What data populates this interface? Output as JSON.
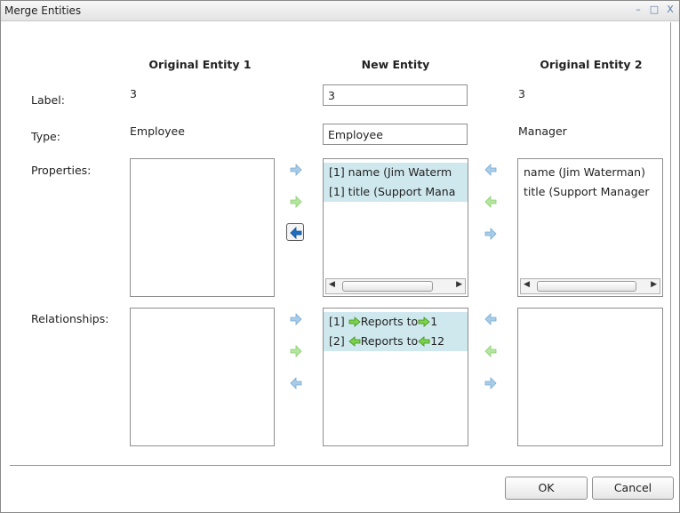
{
  "window": {
    "title": "Merge Entities",
    "minimize": "–",
    "maximize": "□",
    "close": "X"
  },
  "headers": {
    "entity1": "Original Entity 1",
    "new": "New Entity",
    "entity2": "Original Entity 2"
  },
  "labels": {
    "label": "Label:",
    "type": "Type:",
    "properties": "Properties:",
    "relationships": "Relationships:"
  },
  "entity1": {
    "label": "3",
    "type": "Employee",
    "properties": [],
    "relationships": []
  },
  "new_entity": {
    "label": "3",
    "type": "Employee",
    "properties": [
      "[1] name (Jim Waterm",
      "[1] title (Support Mana"
    ],
    "relationships": [
      {
        "prefix": "[1]",
        "text": "Reports to",
        "target": "1",
        "direction": "right"
      },
      {
        "prefix": "[2]",
        "text": "Reports to",
        "target": "12",
        "direction": "left"
      }
    ]
  },
  "entity2": {
    "label": "3",
    "type": "Manager",
    "properties": [
      "name (Jim Waterman)",
      "title (Support Manager"
    ],
    "relationships": []
  },
  "buttons": {
    "ok": "OK",
    "cancel": "Cancel"
  },
  "colors": {
    "blue_arrow": "#6aaee0",
    "blue_arrow_active": "#1f6fc0",
    "green_arrow": "#7cd24a",
    "selection": "#cfe8ee"
  },
  "icons": {
    "arrow_right_blue": "arrow-right-blue-icon",
    "arrow_right_green": "arrow-right-green-icon",
    "arrow_left_blue": "arrow-left-blue-icon",
    "arrow_left_green": "arrow-left-green-icon"
  }
}
